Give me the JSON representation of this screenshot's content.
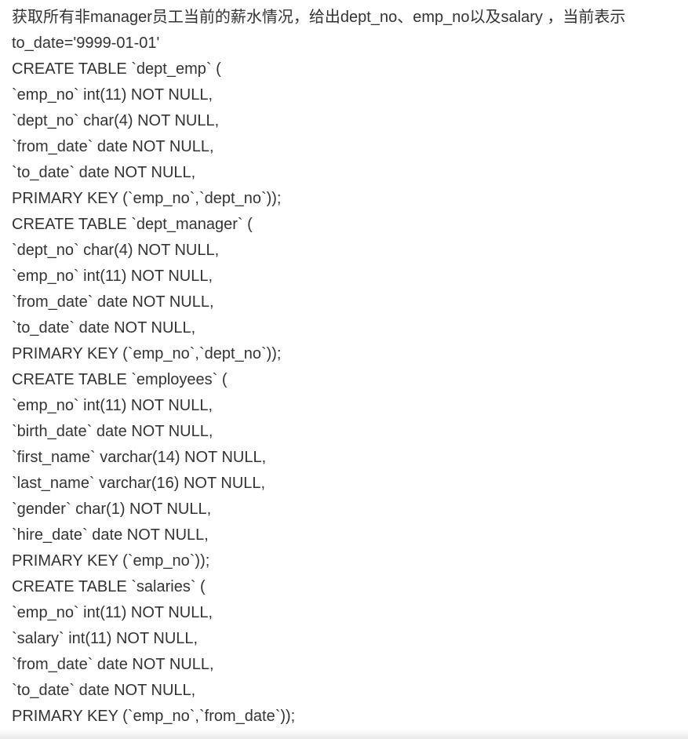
{
  "question": {
    "description": "获取所有非manager员工当前的薪水情况，给出dept_no、emp_no以及salary ，当前表示to_date='9999-01-01'",
    "lines": [
      "CREATE TABLE `dept_emp` (",
      "`emp_no` int(11) NOT NULL,",
      "`dept_no` char(4) NOT NULL,",
      "`from_date` date NOT NULL,",
      "`to_date` date NOT NULL,",
      "PRIMARY KEY (`emp_no`,`dept_no`));",
      "CREATE TABLE `dept_manager` (",
      "`dept_no` char(4) NOT NULL,",
      "`emp_no` int(11) NOT NULL,",
      "`from_date` date NOT NULL,",
      "`to_date` date NOT NULL,",
      "PRIMARY KEY (`emp_no`,`dept_no`));",
      "CREATE TABLE `employees` (",
      "`emp_no` int(11) NOT NULL,",
      "`birth_date` date NOT NULL,",
      "`first_name` varchar(14) NOT NULL,",
      "`last_name` varchar(16) NOT NULL,",
      "`gender` char(1) NOT NULL,",
      "`hire_date` date NOT NULL,",
      "PRIMARY KEY (`emp_no`));",
      "CREATE TABLE `salaries` (",
      "`emp_no` int(11) NOT NULL,",
      "`salary` int(11) NOT NULL,",
      "`from_date` date NOT NULL,",
      "`to_date` date NOT NULL,",
      "PRIMARY KEY (`emp_no`,`from_date`));"
    ]
  },
  "colors": {
    "text": "#333333",
    "background": "#ffffff"
  }
}
